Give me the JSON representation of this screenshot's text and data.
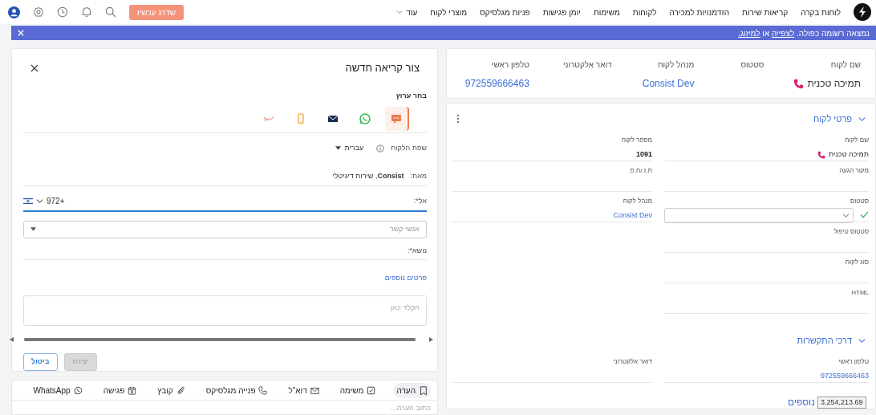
{
  "nav": {
    "items": [
      "לוחות בקרה",
      "קריאות שירות",
      "הזדמנויות למכירה",
      "לקוחות",
      "משימות",
      "יומן פגישות",
      "פניות מגלסיקס",
      "מוצרי לקוח"
    ],
    "more": "עוד",
    "upgrade": "שדרג עכשיו"
  },
  "banner": {
    "text": "נמצאה רשומה כפולה.",
    "link_view": "לצפייה",
    "joiner": "או",
    "link_merge": "למיזוג."
  },
  "summary": [
    {
      "label": "שם לקוח",
      "value": "תמיכה טכנית",
      "kind": "phone"
    },
    {
      "label": "סטטוס",
      "kind": "empty"
    },
    {
      "label": "מנהל לקוח",
      "value": "Consist Dev",
      "kind": "link"
    },
    {
      "label": "דואר אלקטרוני",
      "kind": "empty"
    },
    {
      "label": "טלפון ראשי",
      "value": "972559666463",
      "kind": "link"
    }
  ],
  "details": {
    "title": "פרטי לקוח",
    "expanded": true,
    "rows": [
      [
        {
          "label": "שם לקוח",
          "value": "תמיכה טכנית",
          "kind": "phone"
        },
        {
          "label": "מספר לקוח",
          "value": "1091",
          "kind": "bold"
        }
      ],
      [
        {
          "label": "מקור הגעה",
          "kind": "empty"
        },
        {
          "label": "ת.ז./ח.פ.",
          "kind": "empty"
        }
      ],
      [
        {
          "label": "סטטוס",
          "kind": "select",
          "confirmed": true
        },
        {
          "label": "מנהל לקוח",
          "value": "Consist Dev",
          "kind": "link"
        }
      ],
      [
        {
          "label": "סטטוס טיפול",
          "kind": "empty"
        }
      ],
      [
        {
          "label": "סוג לקוח",
          "kind": "empty"
        }
      ],
      [
        {
          "label": "HTML",
          "kind": "empty"
        }
      ]
    ]
  },
  "contact": {
    "title": "דרכי התקשרות",
    "expanded": true,
    "rows": [
      [
        {
          "label": "טלפון ראשי",
          "value": "972559666463",
          "kind": "link"
        },
        {
          "label": "דואר אלקטרוני",
          "kind": "empty"
        }
      ]
    ]
  },
  "more_link": "נוספים",
  "tooltip": "3,254,213.69",
  "new_call": {
    "title": "צור קריאה חדשה",
    "channel_label": "בחר ערוץ",
    "channels": [
      {
        "kind": "sms",
        "selected": true
      },
      {
        "kind": "whatsapp",
        "selected": false
      },
      {
        "kind": "email",
        "selected": false
      },
      {
        "kind": "mobile",
        "selected": false
      },
      {
        "kind": "chat",
        "selected": false
      }
    ],
    "language_label": "שפת הלקוח",
    "language": "עברית",
    "from_label": "מאת:",
    "from_value": "**Consist**, שירות דיגיטלי",
    "to_label": "אל*:",
    "to_prefix": "+972",
    "contacts_placeholder": "אנשי קשר",
    "subject_label": "נושא*:",
    "more_details": "פרטים נוספים",
    "body_placeholder": "הקלד כאן",
    "create": {
      "label": "יצירה",
      "disabled": true
    },
    "cancel": {
      "label": "ביטול",
      "disabled": false
    }
  },
  "activity": {
    "tabs": [
      {
        "label": "הערה",
        "kind": "bookmark",
        "selected": true
      },
      {
        "label": "משימה",
        "kind": "checkbox",
        "selected": false
      },
      {
        "label": "דוא\"ל",
        "kind": "mail",
        "selected": false
      },
      {
        "label": "פנייה מגלסיקס",
        "kind": "phone",
        "selected": false
      },
      {
        "label": "קובץ",
        "kind": "clip",
        "selected": false
      },
      {
        "label": "פגישה",
        "kind": "calendar",
        "selected": false
      },
      {
        "label": "WhatsApp",
        "kind": "whatsapp",
        "selected": false
      }
    ],
    "note_placeholder": "כתוב הערה..."
  }
}
